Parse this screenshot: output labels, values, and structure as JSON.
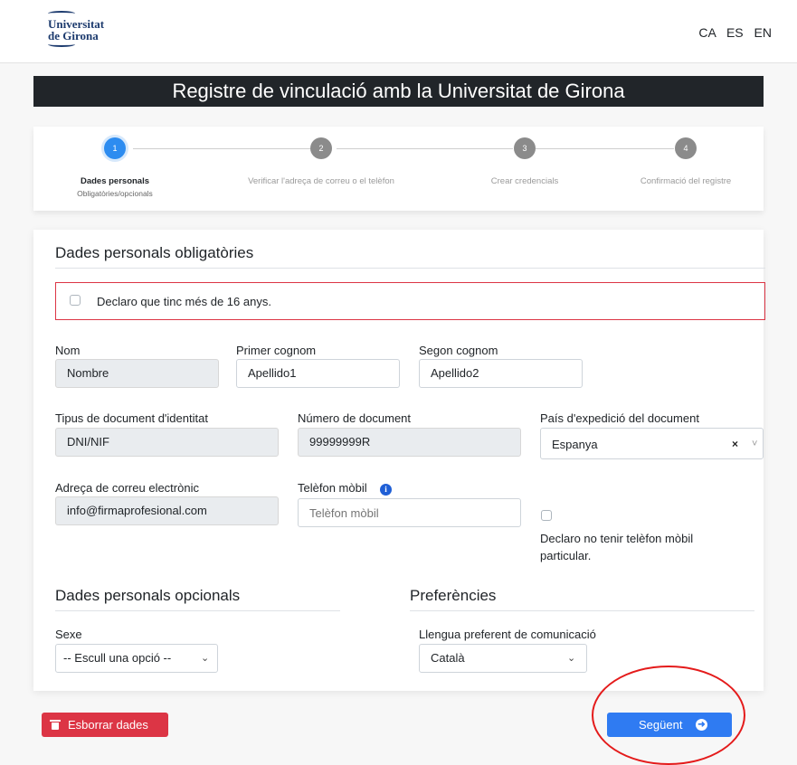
{
  "header": {
    "logo_line1": "Universitat",
    "logo_line2": "de Girona",
    "languages": [
      "CA",
      "ES",
      "EN"
    ]
  },
  "page_title": "Registre de vinculació amb la Universitat de Girona",
  "steps": [
    {
      "number": "1",
      "label": "Dades personals",
      "sublabel": "Obligatòries/opcionals",
      "active": true
    },
    {
      "number": "2",
      "label": "Verificar l'adreça de correu o el telèfon",
      "active": false
    },
    {
      "number": "3",
      "label": "Crear credencials",
      "active": false
    },
    {
      "number": "4",
      "label": "Confirmació del registre",
      "active": false
    }
  ],
  "required_section": {
    "title": "Dades personals obligatòries",
    "age_declaration": "Declaro que tinc més de 16 anys.",
    "nom": {
      "label": "Nom",
      "value": "Nombre"
    },
    "primer_cognom": {
      "label": "Primer cognom",
      "value": "Apellido1"
    },
    "segon_cognom": {
      "label": "Segon cognom",
      "value": "Apellido2"
    },
    "tipus_document": {
      "label": "Tipus de document d'identitat",
      "value": "DNI/NIF"
    },
    "numero_document": {
      "label": "Número de document",
      "value": "99999999R"
    },
    "pais_expedicio": {
      "label": "País d'expedició del document",
      "value": "Espanya",
      "clear_symbol": "×",
      "caret_symbol": "˅"
    },
    "email": {
      "label": "Adreça de correu electrònic",
      "value": "info@firmaprofesional.com"
    },
    "telefon": {
      "label": "Telèfon mòbil",
      "placeholder": "Telèfon mòbil",
      "info_symbol": "i"
    },
    "no_phone_declaration": "Declaro no tenir telèfon mòbil particular."
  },
  "optional_section": {
    "title": "Dades personals opcionals",
    "sexe": {
      "label": "Sexe",
      "value": "-- Escull una opció --"
    }
  },
  "preferences_section": {
    "title": "Preferències",
    "llengua": {
      "label": "Llengua preferent de comunicació",
      "value": "Català"
    }
  },
  "buttons": {
    "delete_label": "Esborrar dades",
    "next_label": "Següent",
    "next_arrow": "➜"
  },
  "colors": {
    "title_bar": "#212529",
    "active_step": "#2d8cf0",
    "danger": "#dc3545",
    "primary": "#2f7bf2",
    "highlight_ellipse": "#e41b1b"
  }
}
